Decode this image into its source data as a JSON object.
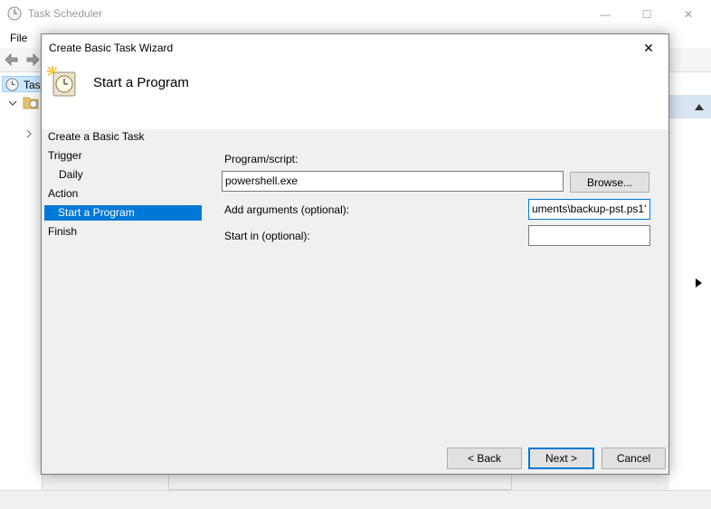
{
  "app": {
    "title": "Task Scheduler",
    "menu": {
      "file_label": "File"
    },
    "tree": {
      "selected_label": "Tas"
    },
    "title_bar_controls": {
      "minimize": "—",
      "maximize": "☐",
      "close": "✕"
    }
  },
  "wizard": {
    "title": "Create Basic Task Wizard",
    "close_glyph": "✕",
    "header_title": "Start a Program",
    "steps": [
      {
        "label": "Create a Basic Task",
        "level": 0,
        "selected": false
      },
      {
        "label": "Trigger",
        "level": 0,
        "selected": false
      },
      {
        "label": "Daily",
        "level": 1,
        "selected": false
      },
      {
        "label": "Action",
        "level": 0,
        "selected": false
      },
      {
        "label": "Start a Program",
        "level": 1,
        "selected": true
      },
      {
        "label": "Finish",
        "level": 0,
        "selected": false
      }
    ],
    "form": {
      "program_label": "Program/script:",
      "program_value": "powershell.exe",
      "browse_label": "Browse...",
      "arguments_label": "Add arguments (optional):",
      "arguments_visible_value": "uments\\backup-pst.ps1'",
      "start_in_label": "Start in (optional):",
      "start_in_value": ""
    },
    "buttons": {
      "back": "< Back",
      "next": "Next >",
      "cancel": "Cancel"
    }
  },
  "colors": {
    "accent": "#0078d7",
    "selection_bg": "#0078d7",
    "dialog_bg": "#f0f0f0"
  },
  "icons": {
    "app": "task-scheduler-clock-icon",
    "header": "task-clock-sun-icon"
  }
}
